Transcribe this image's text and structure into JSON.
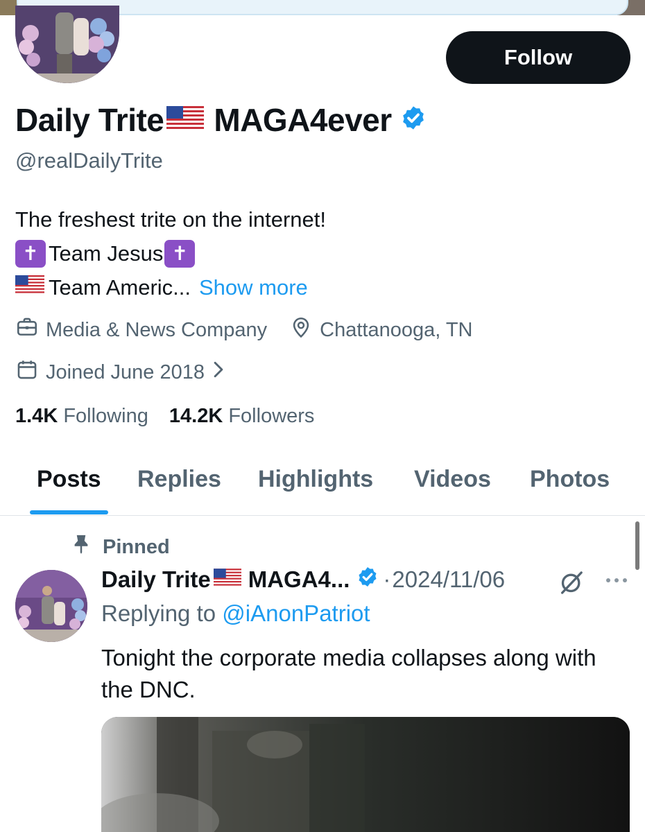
{
  "profile": {
    "display_name_part1": "Daily Trite",
    "display_name_part2": "MAGA4ever",
    "handle": "@realDailyTrite",
    "follow_label": "Follow",
    "bio": {
      "line1": "The freshest trite on the internet!",
      "line2_text": "Team Jesus",
      "cross_glyph": "✝",
      "line3_text": "Team Americ...",
      "show_more": "Show more"
    },
    "category": "Media & News Company",
    "location": "Chattanooga, TN",
    "joined": "Joined June 2018",
    "following_count": "1.4K",
    "following_label": "Following",
    "followers_count": "14.2K",
    "followers_label": "Followers"
  },
  "tabs": [
    {
      "label": "Posts",
      "active": true
    },
    {
      "label": "Replies"
    },
    {
      "label": "Highlights"
    },
    {
      "label": "Videos"
    },
    {
      "label": "Photos"
    }
  ],
  "pinned_post": {
    "pinned_label": "Pinned",
    "author_part1": "Daily Trite",
    "author_part2": "MAGA4...",
    "separator": "·",
    "date": "2024/11/06",
    "replying_prefix": "Replying to",
    "replying_handle": "@iAnonPatriot",
    "text": "Tonight the corporate media collapses along with the DNC."
  },
  "colors": {
    "accent": "#1d9bf0",
    "text_primary": "#0f1419",
    "text_secondary": "#536471",
    "follow_button_bg": "#0f1419",
    "cross_emoji_bg": "#8a4fc6"
  },
  "icons": {
    "verified": "verified-badge-icon",
    "flag": "us-flag-icon",
    "category": "briefcase-icon",
    "location": "location-pin-icon",
    "joined": "calendar-icon",
    "chevron": "chevron-right-icon",
    "pin": "pin-icon",
    "grok": "grok-icon",
    "more": "more-dots-icon"
  }
}
